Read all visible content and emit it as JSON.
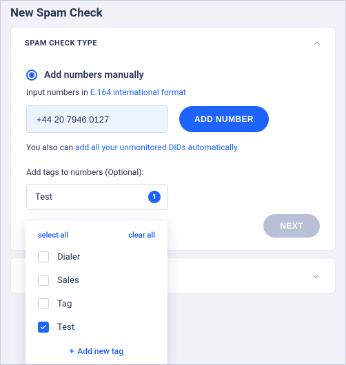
{
  "page_title": "New Spam Check",
  "panel1": {
    "title": "SPAM CHECK TYPE",
    "radio_label": "Add numbers manually",
    "hint_prefix": "Input numbers in ",
    "hint_link": "E.164 international format",
    "number_value": "+44 20 7946 0127",
    "add_number_label": "ADD NUMBER",
    "also_prefix": "You also can ",
    "also_link": "add all your unmonitored DIDs automatically.",
    "tags_label": "Add tags to numbers (Optional):",
    "tags_value": "Test",
    "tags_count": "1",
    "next_label": "NEXT"
  },
  "dropdown": {
    "select_all": "select all",
    "clear_all": "clear all",
    "options": [
      {
        "label": "Dialer",
        "checked": false
      },
      {
        "label": "Sales",
        "checked": false
      },
      {
        "label": "Tag",
        "checked": false
      },
      {
        "label": "Test",
        "checked": true
      }
    ],
    "add_new": "Add new tag"
  }
}
